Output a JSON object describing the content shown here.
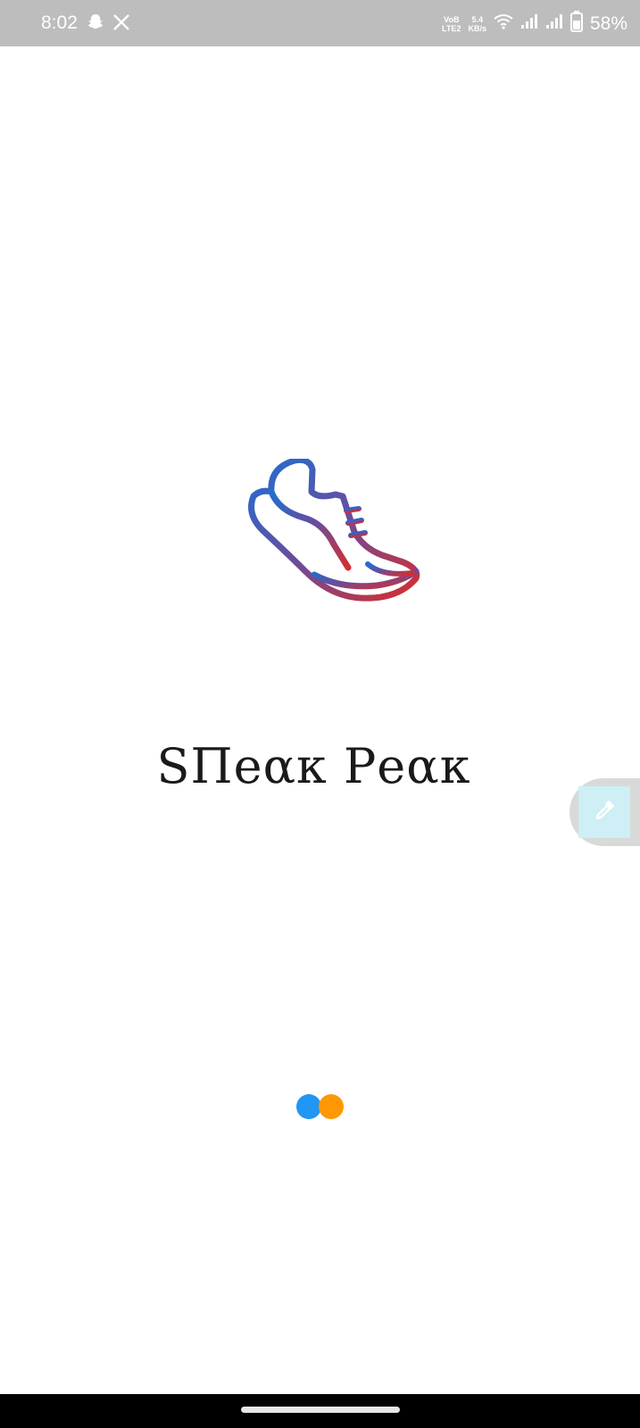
{
  "status_bar": {
    "time": "8:02",
    "left_icons": [
      "snapchat-icon",
      "x-icon"
    ],
    "network_label_top": "VoB",
    "network_label_bottom": "LTE2",
    "speed_value": "5.4",
    "speed_unit": "KB/s",
    "right_icons": [
      "wifi-icon",
      "signal-icon",
      "signal-icon",
      "battery-icon"
    ],
    "battery_percent": "58%"
  },
  "splash": {
    "logo_icon": "running-shoe-icon",
    "app_name": "SΠeακ Pеακ",
    "logo_gradient": [
      "#1f6fd1",
      "#d62e2e"
    ]
  },
  "side_tool": {
    "icon": "eyedropper-icon",
    "background": "#cdeff5"
  },
  "loader": {
    "colors": [
      "#2196F3",
      "#FF9800"
    ]
  },
  "nav_bar": {
    "home_indicator": "home-indicator"
  }
}
